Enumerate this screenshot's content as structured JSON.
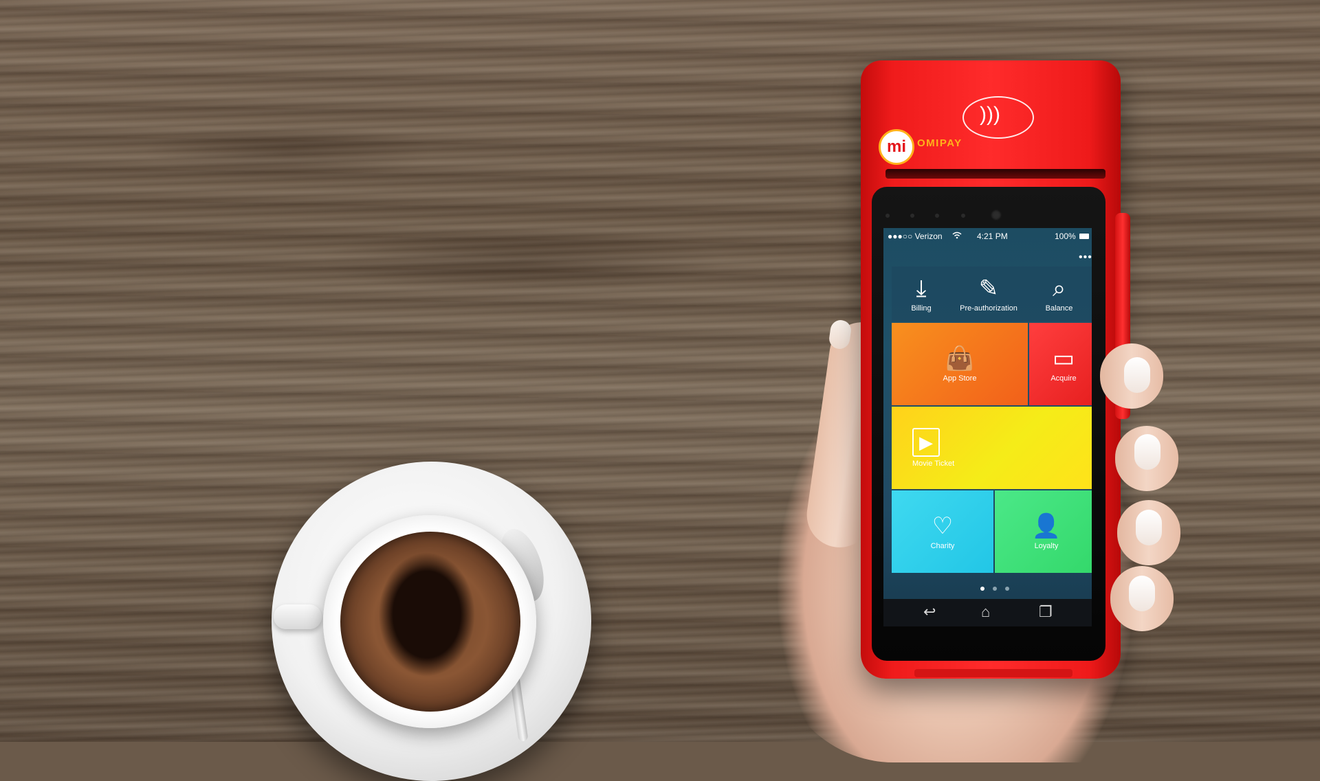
{
  "brand": {
    "logo_mark": "mi",
    "name": "OMIPAY"
  },
  "status_bar": {
    "carrier": "●●●○○ Verizon",
    "wifi_icon": "wifi-icon",
    "time": "4:21 PM",
    "battery": "100%"
  },
  "overflow_menu": "•••",
  "quick_actions": [
    {
      "label": "Billing",
      "icon": "billing-icon"
    },
    {
      "label": "Pre-authorization",
      "icon": "preauth-icon"
    },
    {
      "label": "Balance",
      "icon": "search-icon"
    }
  ],
  "tiles": {
    "app_store": {
      "label": "App Store",
      "color": "#f47a1a",
      "icon": "shopping-bag-icon"
    },
    "acquire": {
      "label": "Acquire",
      "color": "#ea2b2b",
      "icon": "cards-icon"
    },
    "movie_ticket": {
      "label": "Movie Ticket",
      "color": "#f2e01a",
      "icon": "film-icon"
    },
    "charity": {
      "label": "Charity",
      "color": "#2fd2ea",
      "icon": "handshake-heart-icon"
    },
    "loyalty": {
      "label": "Loyalty",
      "color": "#3ddf74",
      "icon": "person-bust-icon"
    }
  },
  "page_indicator": {
    "pages": 3,
    "active": 1
  },
  "nav_buttons": [
    {
      "name": "back-button",
      "icon": "back-icon"
    },
    {
      "name": "home-button",
      "icon": "home-icon"
    },
    {
      "name": "recents-button",
      "icon": "recents-icon"
    }
  ],
  "glyphs": {
    "billing": "⤓",
    "preauth": "✎",
    "balance": "⌕",
    "bag": "👜",
    "cards": "▭",
    "film": "▶",
    "charity": "♡",
    "loyalty": "👤",
    "back": "↩",
    "home": "⌂",
    "recents": "❐",
    "nfc": ")))"
  }
}
